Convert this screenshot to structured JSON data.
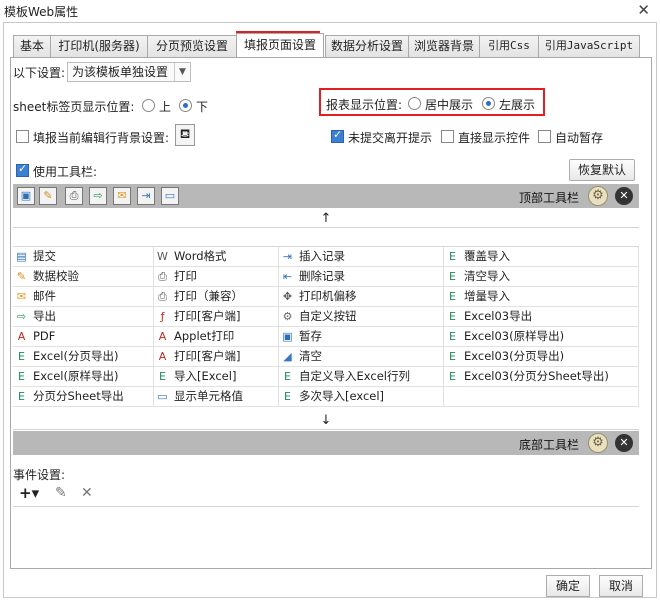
{
  "window": {
    "title": "模板Web属性",
    "close_glyph": "✕"
  },
  "tabs": [
    {
      "label": "基本"
    },
    {
      "label": "打印机(服务器)"
    },
    {
      "label": "分页预览设置"
    },
    {
      "label": "填报页面设置"
    },
    {
      "label": "数据分析设置"
    },
    {
      "label": "浏览器背景"
    },
    {
      "label": "引用Css"
    },
    {
      "label": "引用JavaScript"
    }
  ],
  "settings": {
    "scope_label": "以下设置:",
    "scope_value": "为该模板单独设置",
    "sheet_pos_label": "sheet标签页显示位置:",
    "sheet_top": "上",
    "sheet_bottom": "下",
    "report_pos_label": "报表显示位置:",
    "report_center": "居中展示",
    "report_left": "左展示",
    "fill_bg_label": "填报当前编辑行背景设置:",
    "unsubmitted_leave": "未提交离开提示",
    "show_widget_direct": "直接显示控件",
    "auto_save": "自动暂存",
    "use_toolbar": "使用工具栏:",
    "restore_default": "恢复默认"
  },
  "toolbar": {
    "top_label": "顶部工具栏",
    "bottom_label": "底部工具栏",
    "up_arrow": "↑",
    "down_arrow": "↓"
  },
  "buttons_grid": [
    [
      {
        "label": "提交",
        "icon": "submit-icon",
        "glyph": "▤",
        "color": "#2d6db5"
      },
      {
        "label": "Word格式",
        "icon": "word-icon",
        "glyph": "W",
        "color": "#555"
      },
      {
        "label": "插入记录",
        "icon": "insert-record-icon",
        "glyph": "⇥",
        "color": "#3a76c4"
      },
      {
        "label": "覆盖导入",
        "icon": "excel-icon",
        "glyph": "E",
        "color": "#1f8a5a"
      }
    ],
    [
      {
        "label": "数据校验",
        "icon": "pencil-icon",
        "glyph": "✎",
        "color": "#d68b18"
      },
      {
        "label": "打印",
        "icon": "printer-icon",
        "glyph": "⎙",
        "color": "#555"
      },
      {
        "label": "删除记录",
        "icon": "delete-record-icon",
        "glyph": "⇤",
        "color": "#3a76c4"
      },
      {
        "label": "清空导入",
        "icon": "excel-icon",
        "glyph": "E",
        "color": "#1f8a5a"
      }
    ],
    [
      {
        "label": "邮件",
        "icon": "mail-icon",
        "glyph": "✉",
        "color": "#e39a25"
      },
      {
        "label": "打印（兼容）",
        "icon": "printer-icon",
        "glyph": "⎙",
        "color": "#555"
      },
      {
        "label": "打印机偏移",
        "icon": "move-icon",
        "glyph": "✥",
        "color": "#555"
      },
      {
        "label": "增量导入",
        "icon": "excel-icon",
        "glyph": "E",
        "color": "#1f8a5a"
      }
    ],
    [
      {
        "label": "导出",
        "icon": "export-icon",
        "glyph": "⇨",
        "color": "#2a9a4a"
      },
      {
        "label": "打印[客户端]",
        "icon": "flash-print-icon",
        "glyph": "ƒ",
        "color": "#c0281e"
      },
      {
        "label": "自定义按钮",
        "icon": "gear-icon",
        "glyph": "⚙",
        "color": "#666"
      },
      {
        "label": "Excel03导出",
        "icon": "excel-icon",
        "glyph": "E",
        "color": "#1f8a5a"
      }
    ],
    [
      {
        "label": "PDF",
        "icon": "pdf-icon",
        "glyph": "A",
        "color": "#c0281e"
      },
      {
        "label": "Applet打印",
        "icon": "pdf-icon",
        "glyph": "A",
        "color": "#c0281e"
      },
      {
        "label": "暂存",
        "icon": "save-icon",
        "glyph": "▣",
        "color": "#2d6db5"
      },
      {
        "label": "Excel03(原样导出)",
        "icon": "excel-icon",
        "glyph": "E",
        "color": "#1f8a5a"
      }
    ],
    [
      {
        "label": "Excel(分页导出)",
        "icon": "excel-icon",
        "glyph": "E",
        "color": "#1f8a5a"
      },
      {
        "label": "打印[客户端]",
        "icon": "pdf-icon",
        "glyph": "A",
        "color": "#c0281e"
      },
      {
        "label": "清空",
        "icon": "eraser-icon",
        "glyph": "◢",
        "color": "#3a76c4"
      },
      {
        "label": "Excel03(分页导出)",
        "icon": "excel-icon",
        "glyph": "E",
        "color": "#1f8a5a"
      }
    ],
    [
      {
        "label": "Excel(原样导出)",
        "icon": "excel-icon",
        "glyph": "E",
        "color": "#1f8a5a"
      },
      {
        "label": "导入[Excel]",
        "icon": "excel-icon",
        "glyph": "E",
        "color": "#1f8a5a"
      },
      {
        "label": "自定义导入Excel行列",
        "icon": "excel-icon",
        "glyph": "E",
        "color": "#1f8a5a"
      },
      {
        "label": "Excel03(分页分Sheet导出)",
        "icon": "excel-icon",
        "glyph": "E",
        "color": "#1f8a5a"
      }
    ],
    [
      {
        "label": "分页分Sheet导出",
        "icon": "excel-icon",
        "glyph": "E",
        "color": "#1f8a5a"
      },
      {
        "label": "显示单元格值",
        "icon": "cell-icon",
        "glyph": "▭",
        "color": "#3a76c4"
      },
      {
        "label": "多次导入[excel]",
        "icon": "excel-icon",
        "glyph": "E",
        "color": "#1f8a5a"
      },
      {
        "label": "",
        "icon": "",
        "glyph": "",
        "color": "#fff"
      }
    ]
  ],
  "events": {
    "label": "事件设置:",
    "add": "+▾",
    "edit": "✎",
    "delete": "✕"
  },
  "footer": {
    "ok": "确定",
    "cancel": "取消"
  },
  "colors": {
    "highlight": "#e02020",
    "band": "#b8b8b8"
  }
}
